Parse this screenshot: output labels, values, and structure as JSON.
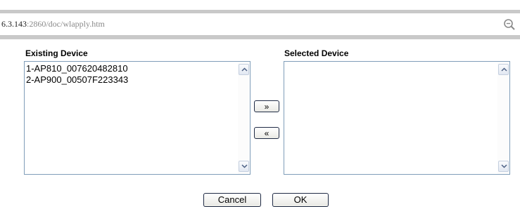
{
  "address_bar": {
    "url_prefix": "6.3.143",
    "url_suffix": ":2860/doc/wlapply.htm",
    "zoom_icon": "magnifier-minus-icon"
  },
  "existing_device": {
    "label": "Existing Device",
    "items": [
      "1-AP810_007620482810",
      "2-AP900_00507F223343"
    ]
  },
  "selected_device": {
    "label": "Selected Device",
    "items": []
  },
  "transfer": {
    "add_label": "»",
    "remove_label": "«"
  },
  "footer": {
    "cancel_label": "Cancel",
    "ok_label": "OK"
  },
  "colors": {
    "listbox_border": "#7f9db9",
    "button_border": "#1f2a44",
    "chrome_band": "#c9c9c9"
  }
}
